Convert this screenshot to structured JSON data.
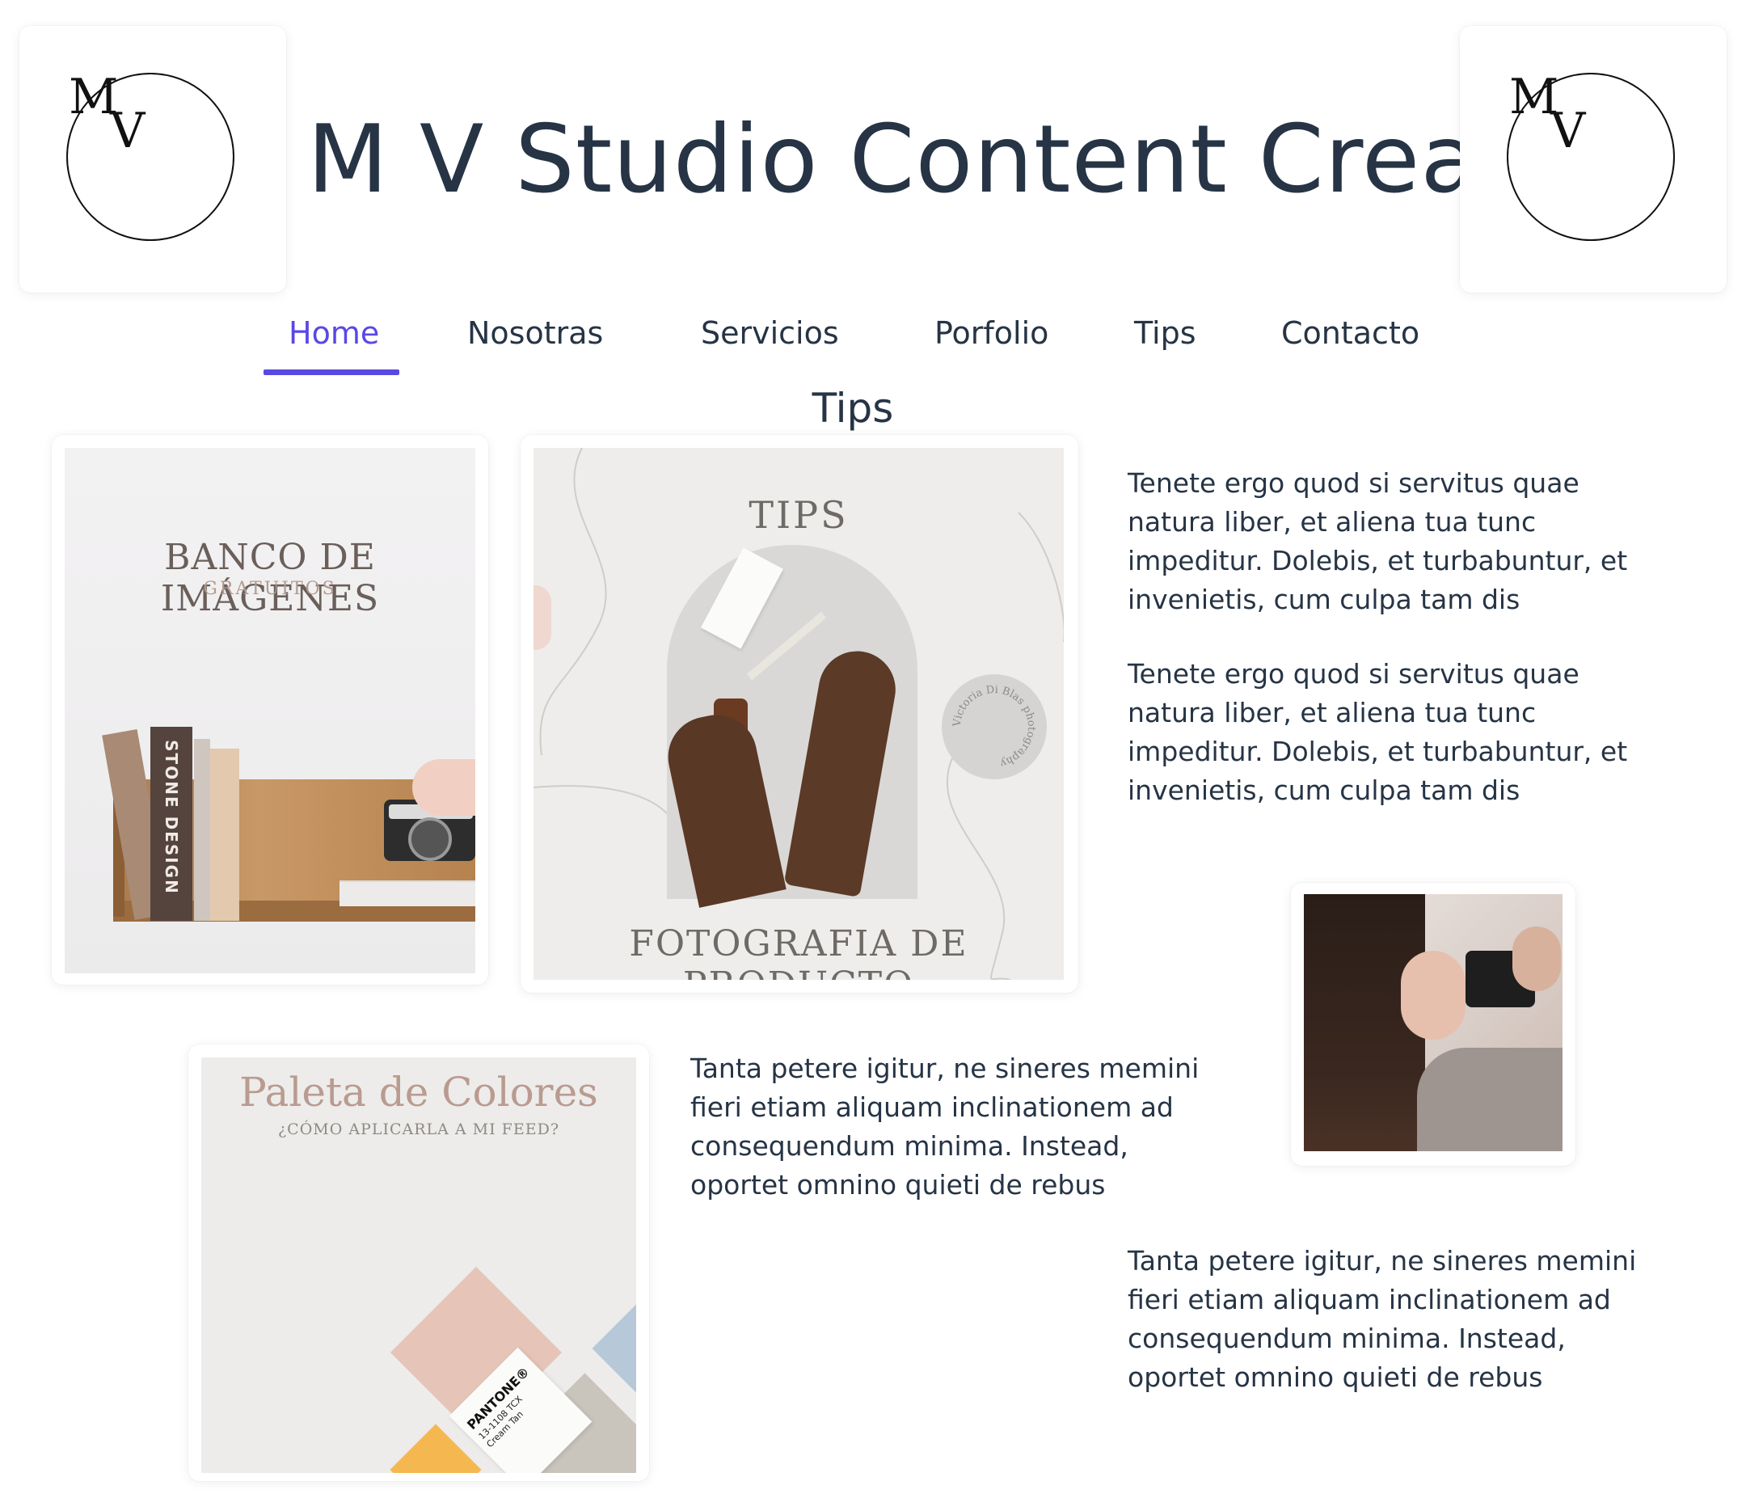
{
  "site": {
    "title": "M V Studio Content Creator"
  },
  "logo": {
    "m": "M",
    "v": "V"
  },
  "nav": {
    "items": [
      {
        "label": "Home",
        "active": true
      },
      {
        "label": "Nosotras"
      },
      {
        "label": "Servicios"
      },
      {
        "label": "Porfolio"
      },
      {
        "label": "Tips"
      },
      {
        "label": "Contacto"
      }
    ]
  },
  "section": {
    "title": "Tips"
  },
  "cards": {
    "banco": {
      "title": "BANCO DE IMÁGENES",
      "subtitle": "GRATUITOS",
      "book_spine": "STONE DESIGN"
    },
    "producto": {
      "tips": "TIPS",
      "caption": "FOTOGRAFIA DE PRODUCTO",
      "stamp": "Victoria Di Blas photography"
    },
    "paleta": {
      "title": "Paleta de Colores",
      "subtitle": "¿CÓMO APLICARLA A MI FEED?",
      "pantone_brand": "PANTONE®",
      "pantone_code": "13-1108 TCX",
      "pantone_name": "Cream Tan"
    }
  },
  "paragraphs": {
    "p1": "Tenete ergo quod si servitus quae natura liber, et aliena tua tunc impeditur. Dolebis, et turbabuntur, et invenietis, cum culpa tam dis",
    "p2": "Tenete ergo quod si servitus quae natura liber, et aliena tua tunc impeditur. Dolebis, et turbabuntur, et invenietis, cum culpa tam dis",
    "p3": "Tanta petere igitur, ne sineres memini fieri etiam aliquam inclinationem ad consequendum minima. Instead, oportet omnino quieti de rebus",
    "p4": "Tanta petere igitur, ne sineres memini fieri etiam aliquam inclinationem ad consequendum minima. Instead, oportet omnino quieti de rebus"
  },
  "colors": {
    "accent": "#5a48e3",
    "text": "#263445",
    "pink": "#e6c5b8",
    "blue": "#b7c9d8",
    "yellow": "#f5b850",
    "taupe": "#c9c4bc"
  }
}
